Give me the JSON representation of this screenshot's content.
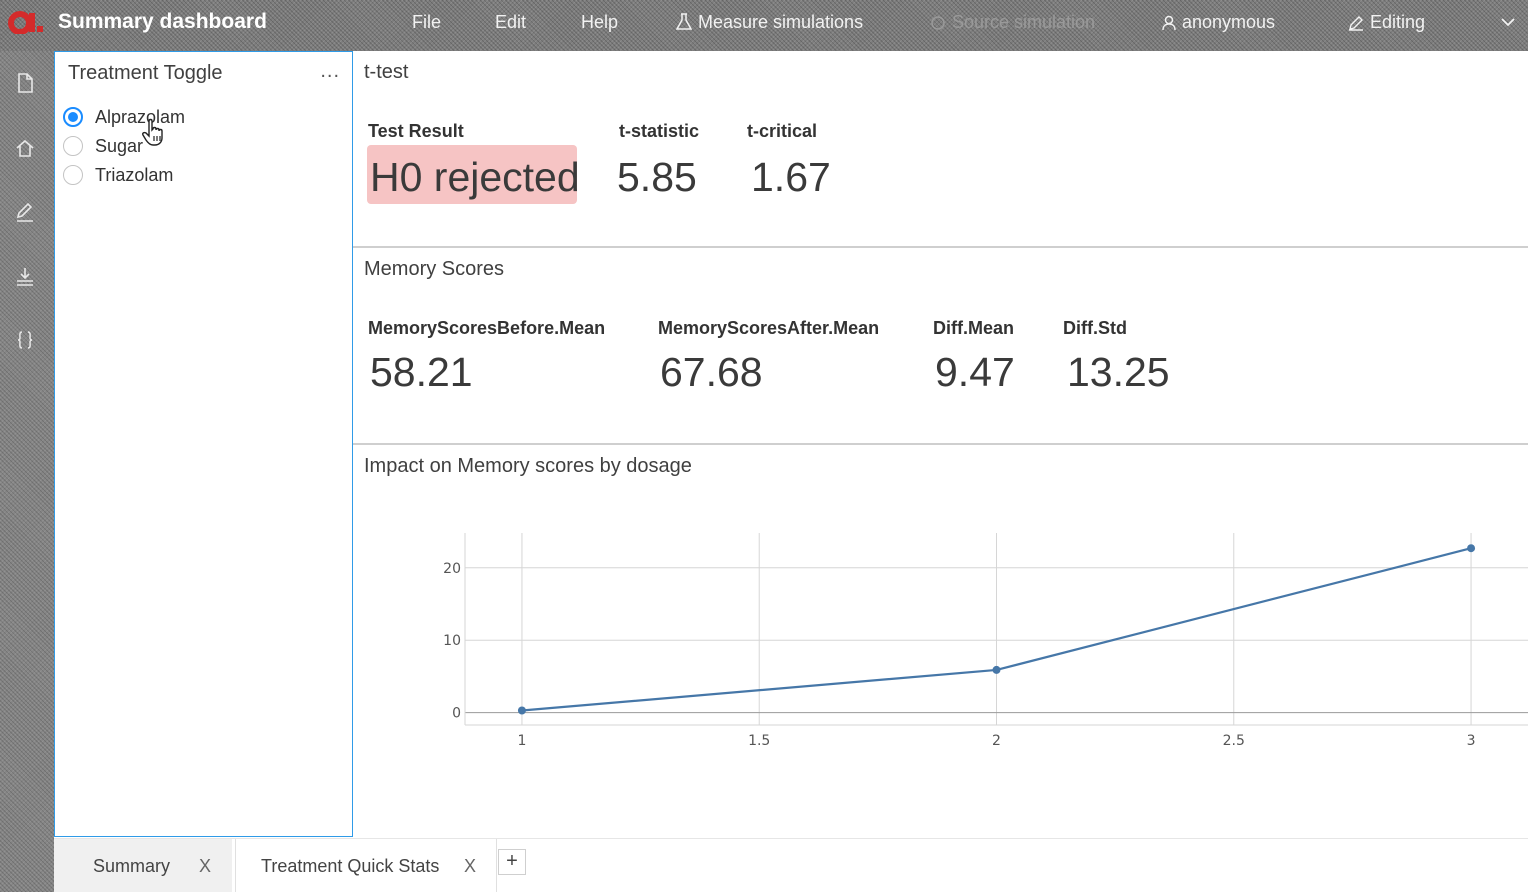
{
  "header": {
    "app_title": "Summary dashboard",
    "menu": [
      {
        "label": "File"
      },
      {
        "label": "Edit"
      },
      {
        "label": "Help"
      },
      {
        "label": "Measure simulations",
        "icon": "flask-icon"
      },
      {
        "label": "Source simulation",
        "icon": "source-icon"
      },
      {
        "label": "anonymous",
        "icon": "user-icon"
      },
      {
        "label": "Editing",
        "icon": "pencil-icon"
      }
    ],
    "colors": {
      "logo": "#d42b2b",
      "bar": "#7d7d7d"
    }
  },
  "sidebar_icons": [
    "file-icon",
    "home-icon",
    "edit-icon",
    "import-icon",
    "braces-icon"
  ],
  "toggle_panel": {
    "title": "Treatment Toggle",
    "menu": "...",
    "options": [
      {
        "label": "Alprazolam",
        "selected": true
      },
      {
        "label": "Sugar",
        "selected": false
      },
      {
        "label": "Triazolam",
        "selected": false
      }
    ]
  },
  "ttest": {
    "title": "t-test",
    "result_label": "Test Result",
    "result_value": "H0 rejected",
    "result_color": "#f6c4c4",
    "tstat_label": "t-statistic",
    "tstat_value": "5.85",
    "tcrit_label": "t-critical",
    "tcrit_value": "1.67"
  },
  "memory": {
    "title": "Memory Scores",
    "before_label": "MemoryScoresBefore.Mean",
    "before_value": "58.21",
    "after_label": "MemoryScoresAfter.Mean",
    "after_value": "67.68",
    "diff_mean_label": "Diff.Mean",
    "diff_mean_value": "9.47",
    "diff_std_label": "Diff.Std",
    "diff_std_value": "13.25"
  },
  "impact": {
    "title": "Impact on Memory scores by dosage"
  },
  "chart_data": {
    "type": "line",
    "title": "Impact on Memory scores by dosage",
    "x": [
      1,
      2,
      3
    ],
    "series": [
      {
        "values": [
          0.3,
          5.9,
          22.7
        ],
        "color": "#4677a8"
      }
    ],
    "xticks": [
      "1",
      "1.5",
      "2",
      "2.5",
      "3"
    ],
    "yticks": [
      "0",
      "10",
      "20"
    ],
    "xlim": [
      0.88,
      3.12
    ],
    "ylim": [
      -1.7,
      24.8
    ],
    "grid": true
  },
  "tabs": {
    "items": [
      {
        "label": "Summary",
        "close": "X",
        "active": false
      },
      {
        "label": "Treatment Quick Stats",
        "close": "X",
        "active": true
      }
    ],
    "add": "+"
  }
}
